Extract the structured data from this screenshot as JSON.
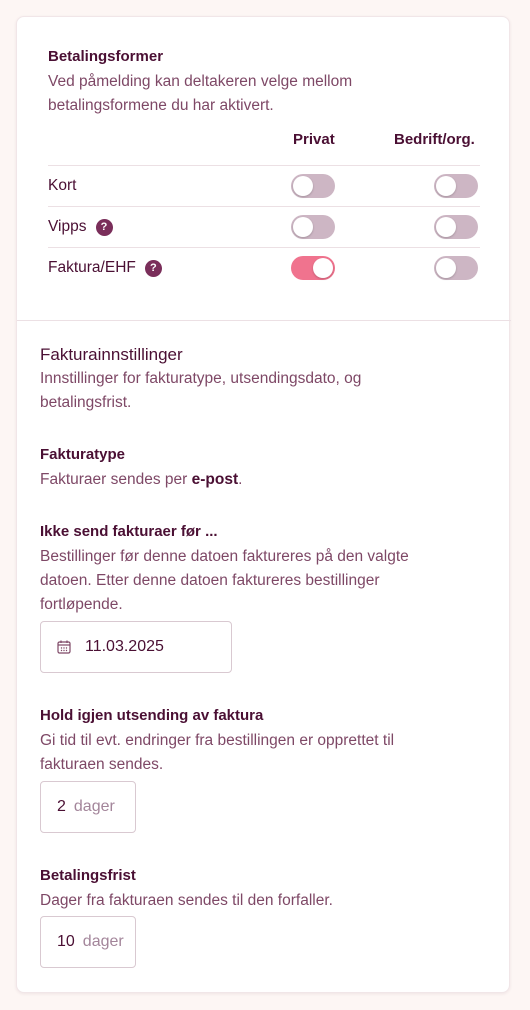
{
  "payment": {
    "title": "Betalingsformer",
    "description": "Ved påmelding kan deltakeren velge mellom betalingsformene du har aktivert.",
    "col_private": "Privat",
    "col_business": "Bedrift/org.",
    "rows": [
      {
        "label": "Kort",
        "help": false,
        "private_on": false,
        "business_on": false
      },
      {
        "label": "Vipps",
        "help": true,
        "private_on": false,
        "business_on": false
      },
      {
        "label": "Faktura/EHF",
        "help": true,
        "private_on": true,
        "business_on": false
      }
    ],
    "help_glyph": "?"
  },
  "invoice": {
    "title": "Fakturainnstillinger",
    "description": "Innstillinger for fakturatype, utsendingsdato, og betalingsfrist.",
    "type_title": "Fakturatype",
    "type_desc_prefix": "Fakturaer sendes per ",
    "type_desc_bold": "e-post",
    "type_desc_suffix": ".",
    "notbefore_title": "Ikke send fakturaer før ...",
    "notbefore_desc": "Bestillinger før denne datoen faktureres på den valgte datoen. Etter denne datoen faktureres bestillinger fortløpende.",
    "notbefore_date": "11.03.2025",
    "hold_title": "Hold igjen utsending av faktura",
    "hold_desc": "Gi tid til evt. endringer fra bestillingen er opprettet til fakturaen sendes.",
    "hold_value": "2",
    "hold_unit": "dager",
    "due_title": "Betalingsfrist",
    "due_desc": "Dager fra fakturaen sendes til den forfaller.",
    "due_value": "10",
    "due_unit": "dager"
  },
  "colors": {
    "toggle_on": "#f0738e",
    "toggle_off": "#cdb6c4",
    "text_primary": "#4a0f33",
    "text_secondary": "#7e4866"
  }
}
